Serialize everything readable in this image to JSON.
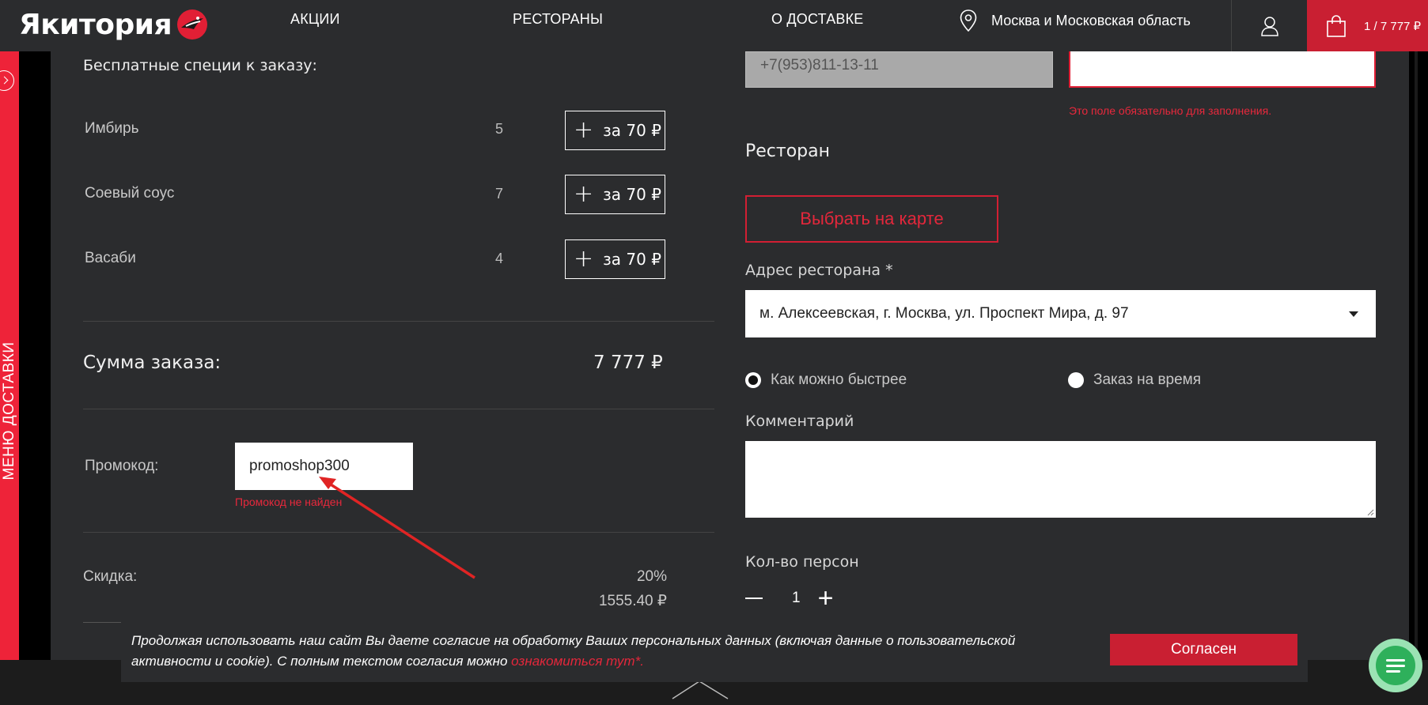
{
  "header": {
    "logo_text": "Якитория",
    "nav": [
      "АКЦИИ",
      "РЕСТОРАНЫ",
      "О ДОСТАВКЕ"
    ],
    "location": "Москва и Московская область",
    "cart": "1 / 7 777 ₽"
  },
  "side_tab": {
    "label": "МЕНЮ ДОСТАВКИ"
  },
  "order": {
    "free_spices_title": "Бесплатные специи к заказу:",
    "spices": [
      {
        "name": "Имбирь",
        "count": "5",
        "button": "за 70 ₽"
      },
      {
        "name": "Соевый соус",
        "count": "7",
        "button": "за 70 ₽"
      },
      {
        "name": "Васаби",
        "count": "4",
        "button": "за 70 ₽"
      }
    ],
    "sum_label": "Сумма заказа:",
    "sum_value": "7 777 ₽",
    "promo_label": "Промокод:",
    "promo_value": "promoshop300",
    "promo_error": "Промокод не найден",
    "discount_label": "Скидка:",
    "discount_percent": "20%",
    "discount_amount": "1555.40 ₽"
  },
  "form": {
    "phone_value": "+7(953)811-13-11",
    "name_error": "Это поле обязательно для заполнения.",
    "restaurant_title": "Ресторан",
    "map_button": "Выбрать на карте",
    "address_label": "Адрес ресторана *",
    "address_value": "м. Алексеевская, г. Москва, ул. Проспект Мира, д. 97",
    "radio_asap": "Как можно быстрее",
    "radio_time": "Заказ на время",
    "comment_label": "Комментарий",
    "persons_label": "Кол-во персон",
    "persons_value": "1"
  },
  "cookie": {
    "text": "Продолжая использовать наш сайт Вы даете согласие на обработку Ваших персональных данных (включая данные о пользовательской активности и cookie). С полным текстом согласия можно ",
    "link": "ознакомиться тут*.",
    "button": "Согласен"
  },
  "colors": {
    "accent": "#c91f32",
    "error": "#e8283c",
    "panel": "#2b2c2e"
  }
}
